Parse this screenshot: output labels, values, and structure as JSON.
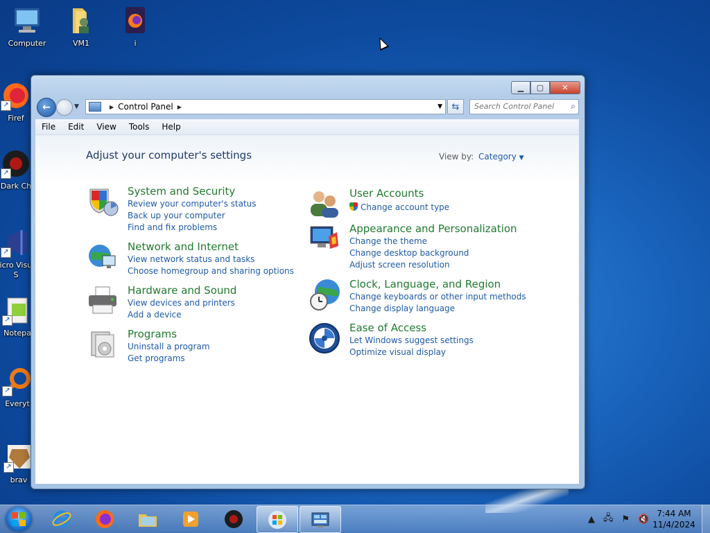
{
  "desktop": {
    "icons": [
      {
        "label": "Computer"
      },
      {
        "label": "VM1"
      },
      {
        "label": "i"
      },
      {
        "label": "Firef"
      },
      {
        "label": "Dark Ch"
      },
      {
        "label": "Micro Visual S"
      },
      {
        "label": "Notepa"
      },
      {
        "label": "Everyt"
      },
      {
        "label": "brav"
      }
    ]
  },
  "window": {
    "address": {
      "crumb": "Control Panel"
    },
    "search": {
      "placeholder": "Search Control Panel"
    },
    "menu": [
      "File",
      "Edit",
      "View",
      "Tools",
      "Help"
    ],
    "page_title": "Adjust your computer's settings",
    "view_by": {
      "label": "View by:",
      "value": "Category"
    },
    "categories_left": [
      {
        "title": "System and Security",
        "icon": "shield-icon",
        "links": [
          "Review your computer's status",
          "Back up your computer",
          "Find and fix problems"
        ]
      },
      {
        "title": "Network and Internet",
        "icon": "network-icon",
        "links": [
          "View network status and tasks",
          "Choose homegroup and sharing options"
        ]
      },
      {
        "title": "Hardware and Sound",
        "icon": "printer-icon",
        "links": [
          "View devices and printers",
          "Add a device"
        ]
      },
      {
        "title": "Programs",
        "icon": "programs-icon",
        "links": [
          "Uninstall a program",
          "Get programs"
        ]
      }
    ],
    "categories_right": [
      {
        "title": "User Accounts",
        "icon": "users-icon",
        "links": [
          "Change account type"
        ]
      },
      {
        "title": "Appearance and Personalization",
        "icon": "appearance-icon",
        "links": [
          "Change the theme",
          "Change desktop background",
          "Adjust screen resolution"
        ]
      },
      {
        "title": "Clock, Language, and Region",
        "icon": "globe-clock-icon",
        "links": [
          "Change keyboards or other input methods",
          "Change display language"
        ]
      },
      {
        "title": "Ease of Access",
        "icon": "ease-of-access-icon",
        "links": [
          "Let Windows suggest settings",
          "Optimize visual display"
        ]
      }
    ]
  },
  "taskbar": {
    "clock": {
      "time": "7:44 AM",
      "date": "11/4/2024"
    }
  },
  "colors": {
    "category_title": "#1f7a2e",
    "link": "#1e5aa8",
    "heading": "#1e3a6d"
  }
}
